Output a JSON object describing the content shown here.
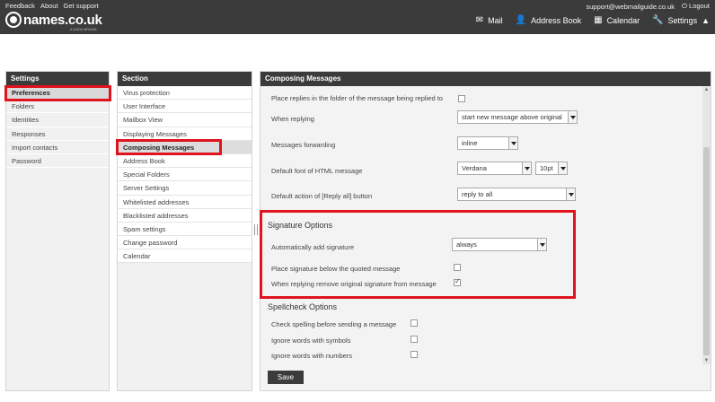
{
  "top": {
    "links": [
      "Feedback",
      "About",
      "Get support"
    ],
    "email": "support@webmailguide.co.uk",
    "logout": "Logout"
  },
  "logo": {
    "brand": "names.co.uk",
    "tagline": "A DADA BRAND"
  },
  "nav": [
    {
      "label": "Mail",
      "icon": "mail-icon"
    },
    {
      "label": "Address Book",
      "icon": "person-icon"
    },
    {
      "label": "Calendar",
      "icon": "calendar-icon"
    },
    {
      "label": "Settings",
      "icon": "wrench-icon"
    }
  ],
  "settings": {
    "title": "Settings",
    "items": [
      "Preferences",
      "Folders",
      "Identities",
      "Responses",
      "Import contacts",
      "Password"
    ],
    "active": "Preferences"
  },
  "section": {
    "title": "Section",
    "items": [
      "Virus protection",
      "User Interface",
      "Mailbox View",
      "Displaying Messages",
      "Composing Messages",
      "Address Book",
      "Special Folders",
      "Server Settings",
      "Whitelisted addresses",
      "Blacklisted addresses",
      "Spam settings",
      "Change password",
      "Calendar"
    ],
    "active": "Composing Messages"
  },
  "content": {
    "title": "Composing Messages",
    "replies_folder_label": "Place replies in the folder of the message being replied to",
    "when_replying_label": "When replying",
    "when_replying_value": "start new message above original",
    "forwarding_label": "Messages forwarding",
    "forwarding_value": "inline",
    "default_font_label": "Default font of HTML message",
    "font_value": "Verdana",
    "font_size_value": "10pt",
    "reply_all_label": "Default action of [Reply all] button",
    "reply_all_value": "reply to all",
    "signature": {
      "title": "Signature Options",
      "auto_add_label": "Automatically add signature",
      "auto_add_value": "always",
      "below_quoted_label": "Place signature below the quoted message",
      "remove_original_label": "When replying remove original signature from message"
    },
    "spellcheck": {
      "title": "Spellcheck Options",
      "before_send_label": "Check spelling before sending a message",
      "ignore_symbols_label": "Ignore words with symbols",
      "ignore_numbers_label": "Ignore words with numbers"
    },
    "save_label": "Save"
  }
}
